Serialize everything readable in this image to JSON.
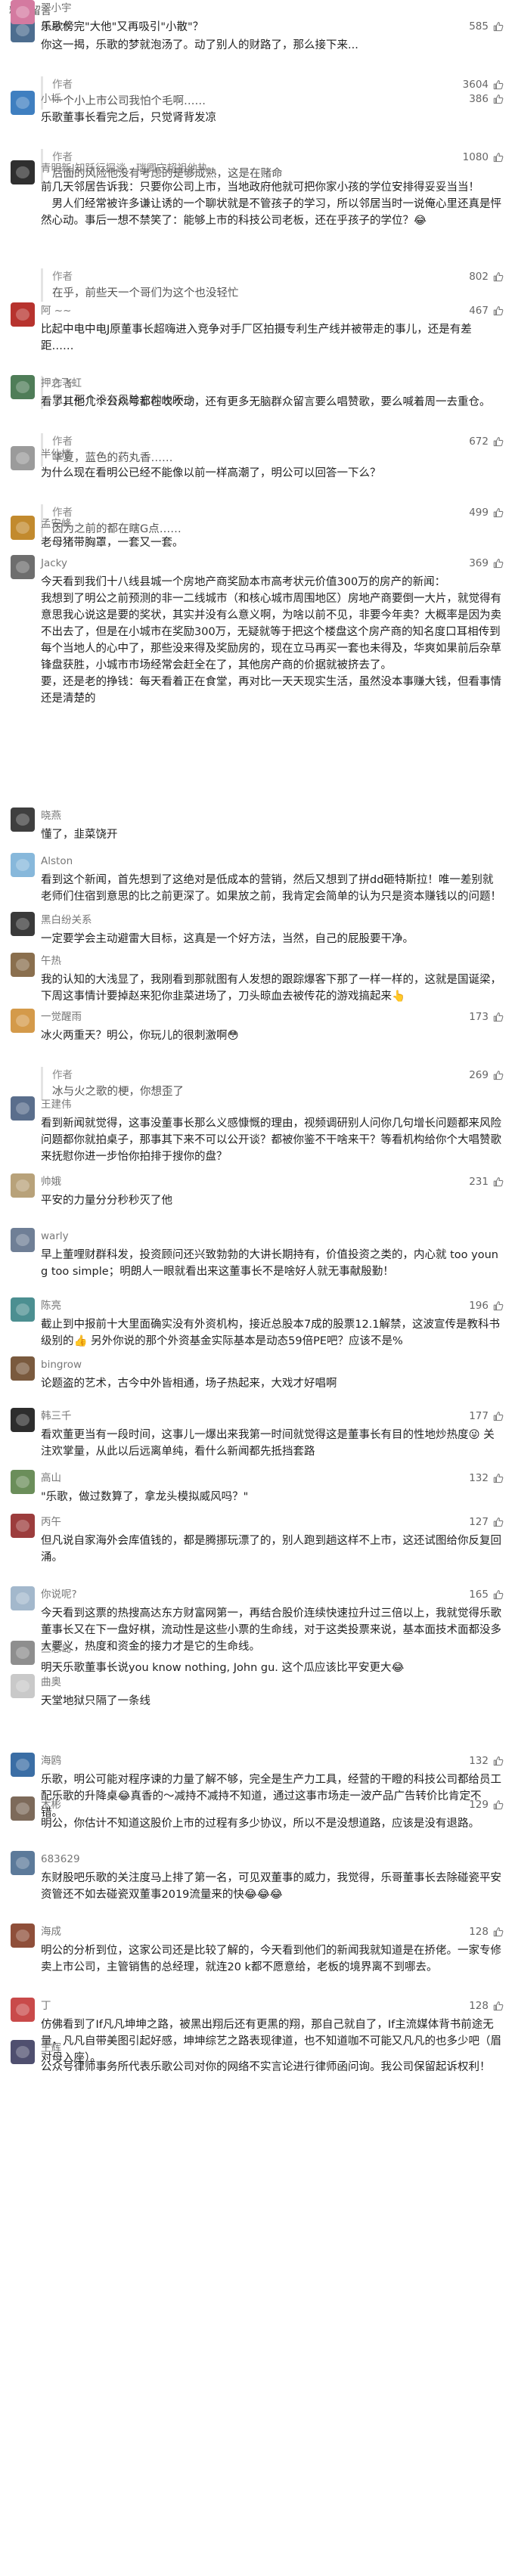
{
  "section": {
    "title": "精选留言"
  },
  "comments": [
    {
      "name": "美月木",
      "likes": "585",
      "avatar_color": "#4d6d8f",
      "content": "你这一揭，乐歌的梦就泡汤了。动了别人的财路了，那么接下来...",
      "reply": {
        "author": "作者",
        "likes": "3604",
        "text": "一个小上市公司我怕个毛啊……"
      }
    },
    {
      "name": "小栎",
      "likes": "386",
      "avatar_color": "#3f7fc0",
      "content": "乐歌董事长看完之后，只觉肾背发凉",
      "reply": {
        "author": "作者",
        "likes": "1080",
        "text": "后面的风险他没有考虑的是够成熟，这是在赌命"
      }
    },
    {
      "name": "青明新|知跃行探谈 - 瑞卿守超祖他热",
      "likes": "",
      "avatar_color": "#2f2f2f",
      "content": "前几天邻居告诉我：只要你公司上市，当地政府他就可把你家小孩的学位安排得妥妥当当！\n　男人们经常被许多谦让诱的一个聊状就是不管孩子的学习，所以邻居当时一说俺心里还真是怦然心动。事后一想不禁笑了：能够上市的科技公司老板，还在乎孩子的学位？😂",
      "reply": {
        "author": "作者",
        "likes": "802",
        "text": "在乎，前些天一个哥们为这个也没轻忙"
      }
    },
    {
      "name": "阿 ~~",
      "likes": "467",
      "avatar_color": "#b7332e",
      "content": "比起中电中电J原董事长超嗨进入竞争对手厂区拍摄专利生产线并被带走的事儿，还是有差距……",
      "reply": {
        "author": "作者",
        "likes": "",
        "text": "恩，那个没有风险它的也不少"
      }
    },
    {
      "name": "押之飞虹",
      "likes": "",
      "avatar_color": "#4f7d58",
      "content": "看了其他几个公众号都在吹吹动，还有更多无脑群众留言要么唱赞歌，要么喊着周一去重仓。",
      "reply": {
        "author": "作者",
        "likes": "672",
        "text": "华夏，蓝色的药丸香……"
      }
    },
    {
      "name": "半仙楼",
      "likes": "",
      "avatar_color": "#9b9b9b",
      "content": "为什么现在看明公已经不能像以前一样高潮了，明公可以回答一下么？",
      "reply": {
        "author": "作者",
        "likes": "499",
        "text": "因为之前的都在瞎G点……"
      }
    },
    {
      "name": "孟安峰",
      "likes": "",
      "avatar_color": "#c28a2e",
      "content": "老母猪带胸罩，一套又一套。",
      "reply": null
    },
    {
      "name": "Jacky",
      "likes": "369",
      "avatar_color": "#6e6e6e",
      "content": "今天看到我们十八线县城一个房地产商奖励本市高考状元价值300万的房产的新闻：\n我想到了明公之前预测的非一二线城市（和核心城市周围地区）房地产商要倒一大片，就觉得有意思我心说这是要的奖状，其实并没有么意义啊，为啥以前不见，非要今年卖？大概率是因为卖不出去了，但是在小城市在奖励300万，无疑就等于把这个楼盘这个房产商的知名度口耳相传到每个当地人的心中了，那些没来得及奖励房的，现在立马再买一套也未得及，华爽如果前后杂草锋盘获胜，小城市市场经常会赶全在了，其他房产商的价据就被挤去了。\n要，还是老的挣钱：每天看着正在食堂，再对比一天天现实生活，虽然没本事赚大钱，但看事情还是清楚的",
      "reply": null
    },
    {
      "name": "晓燕",
      "likes": "",
      "avatar_color": "#3f3f3f",
      "content": "懂了，韭菜饶开",
      "reply": null
    },
    {
      "name": "Alston",
      "likes": "",
      "avatar_color": "#87b8db",
      "content": "看到这个新闻，首先想到了这绝对是低成本的营销，然后又想到了拼dd砸特斯拉！唯一差别就老师们住宿到意思的比之前更深了。如果放之前，我肯定会简单的认为只是资本赚钱以的问题！",
      "reply": null
    },
    {
      "name": "黑白纷关系",
      "likes": "",
      "avatar_color": "#3a3a3a",
      "content": "一定要学会主动避雷大目标，这真是一个好方法，当然，自己的屁股要干净。",
      "reply": null
    },
    {
      "name": "午热",
      "likes": "",
      "avatar_color": "#8a6f4e",
      "content": "我的认知的大浅显了，我刚看到那就图有人发想的跟踪爆客下那了一样一样的，这就是国诞梁，下周这事情计要掉赵来犯你韭菜进场了，刀头晾血去被传花的游戏搞起来👆",
      "reply": null
    },
    {
      "name": "一觉醒雨",
      "likes": "173",
      "avatar_color": "#d49a4a",
      "content": "冰火两重天？明公，你玩儿的很刺激啊😳",
      "reply": {
        "author": "作者",
        "likes": "269",
        "text": "冰与火之歌的梗，你想歪了"
      }
    },
    {
      "name": "王建伟",
      "likes": "",
      "avatar_color": "#5a6e8c",
      "content": "看到新闻就觉得，这事没董事长那么义感慷慨的理由，视频调研别人问你几句增长问题都来风险问题都你就拍桌子，那事其下来不可以公开谈？都被你鉴不干啥来干？等看机构给你个大唱赞歌来抚慰你进一步怡你拍排于搜你的盘？",
      "reply": null
    },
    {
      "name": "帅娥",
      "likes": "231",
      "avatar_color": "#b8a27a",
      "content": "平安的力量分分秒秒灭了他",
      "reply": null
    },
    {
      "name": "warly",
      "likes": "",
      "avatar_color": "#6f7f96",
      "content": "早上董哩财群科发，投资顾问还兴致勃勃的大讲长期持有，价值投资之类的，内心就 too young too simple；明朗人一眼就看出来这董事长不是啥好人就无事献殷勤！",
      "reply": null
    },
    {
      "name": "陈亮",
      "likes": "196",
      "avatar_color": "#4c8f91",
      "content": "截止到中报前十大里面确实没有外资机构，接近总股本7成的股票12.1解禁，这波宣传是教科书级别的👍 另外你说的那个外资基金实际基本是动态59倍PE吧？应该不是%",
      "reply": null
    },
    {
      "name": "bingrow",
      "likes": "",
      "avatar_color": "#7a5a3e",
      "content": "论题盗的艺术，古今中外皆相通，场子热起来，大戏才好唱啊",
      "reply": null
    },
    {
      "name": "韩三千",
      "likes": "177",
      "avatar_color": "#2d2d2d",
      "content": "看欢董更当有一段时间，这事儿一爆出来我第一时间就觉得这是董事长有目的性地炒热度😜 关注欢掌量，从此以后远离单纯，看什么新闻都先抵挡套路",
      "reply": null
    },
    {
      "name": "高山",
      "likes": "132",
      "avatar_color": "#6b8e5a",
      "content": "\"乐歌，做过数算了，拿龙头模拟威风吗？\"",
      "reply": null
    },
    {
      "name": "丙午",
      "likes": "127",
      "avatar_color": "#9c3d3d",
      "content": "但凡说自家海外会库值钱的，都是腾挪玩漂了的，别人跑到趟这样不上市，这还试图给你反复回涌。",
      "reply": null
    },
    {
      "name": "你说呢?",
      "likes": "165",
      "avatar_color": "#a3b8cc",
      "content": "今天看到这票的热搜高达东方财富网第一，再结合股价连续快速拉升过三倍以上，我就觉得乐歌董事长又在下一盘好棋，流动性是这些小票的生命线，对于这类投票来说，基本面技术面都没多大要义，热度和资金的接力才是它的生命线。",
      "reply": null
    },
    {
      "name": "兰思岛",
      "likes": "",
      "avatar_color": "#8e8e8e",
      "content": "明天乐歌董事长说you know nothing, John gu. 这个瓜应该比平安更大😂",
      "reply": null
    },
    {
      "name": "曲奥",
      "likes": "",
      "avatar_color": "#c9c9c9",
      "content": "天堂地狱只隔了一条线",
      "reply": null
    },
    {
      "name": "海鸥",
      "likes": "132",
      "avatar_color": "#3b6ea5",
      "content": "乐歌，明公可能对程序谏的力量了解不够，完全是生产力工具，经营的干瞪的科技公司都给员工配乐歌的升降桌😂真香的～减持不减持不知道，通过这事市场走一波产品广告转价比肯定不错。",
      "reply": null
    },
    {
      "name": "木彬",
      "likes": "129",
      "avatar_color": "#7d6a5a",
      "content": "明公，你估计不知道这股价上市的过程有多少协议，所以不是没想道路，应该是没有退路。",
      "reply": null
    },
    {
      "name": "683629",
      "likes": "",
      "avatar_color": "#5c7a9a",
      "content": "东财股吧乐歌的关注度马上排了第一名，可见双董事的威力，我觉得，乐哥董事长去除碰瓷平安资管还不如去碰瓷双董事2019流量来的快😂😂😂",
      "reply": null
    },
    {
      "name": "海成",
      "likes": "128",
      "avatar_color": "#8f4f3a",
      "content": "明公的分析到位，这家公司还是比较了解的，今天看到他们的新闻我就知道是在挢佬。一家专修卖上市公司，主管销售的总经理，就连20 k都不愿意给，老板的境界离不到哪去。",
      "reply": null
    },
    {
      "name": "丁",
      "likes": "128",
      "avatar_color": "#c94a4a",
      "content": "仿佛看到了If凡凡坤坤之路，被黑出翔后还有更黑的翔，那自己就自了，If主流媒体背书前途无量，凡凡自带美图引起好感，坤坤综艺之路表现律道，也不知道咖不可能又凡凡的也多少吧（眉对母入座）。",
      "reply": null
    },
    {
      "name": "王辉",
      "likes": "",
      "avatar_color": "#4f4f6f",
      "content": "公众号律师事务所代表乐歌公司对你的网络不实言论进行律师函问询。我公司保留起诉权利！",
      "reply": null
    },
    {
      "name": "翠小宇",
      "likes": "",
      "avatar_color": "#d47aa0",
      "content": "乐歌傍完\"大他\"又再吸引\"小散\"？",
      "reply": null
    }
  ]
}
